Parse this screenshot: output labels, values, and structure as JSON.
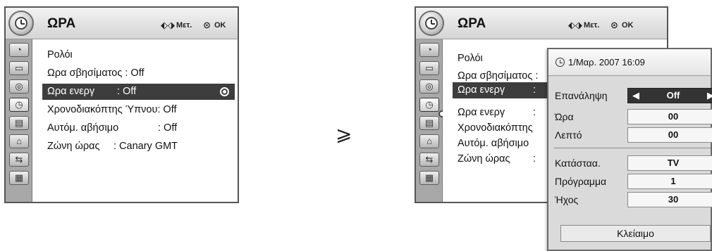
{
  "left_panel": {
    "title": "ΩΡΑ",
    "hint_move": "Μετ.",
    "hint_ok": "OK",
    "items": [
      {
        "label": "Ρολόι",
        "value": ""
      },
      {
        "label": "Ωρα σβησίματος : Off",
        "value": ""
      },
      {
        "label": "Ωρα ενεργ",
        "value": ": Off"
      },
      {
        "label": "Χρονοδιακόπτης Ύπνου: Off",
        "value": ""
      },
      {
        "label": "Αυτόμ. αβήσιμο",
        "value": ": Off"
      },
      {
        "label": "Ζώνη ώρας",
        "value": ": Canary GMT"
      }
    ]
  },
  "right_panel": {
    "title": "ΩΡΑ",
    "hint_move": "Μετ.",
    "hint_ok": "OK",
    "items": [
      {
        "label": "Ρολόι"
      },
      {
        "label": "Ωρα σβησίματος :"
      },
      {
        "label": "Ωρα ενεργ"
      },
      {
        "label": "Ωρα ενεργ"
      },
      {
        "label": "Χρονοδιακόπτης"
      },
      {
        "label": "Αυτόμ. αβήσιμο"
      },
      {
        "label": "Ζώνη ώρας"
      }
    ],
    "colons": [
      ":",
      ":",
      ":"
    ]
  },
  "popup": {
    "datetime": "1/Μαρ. 2007 16:09",
    "rows": [
      {
        "label": "Επανάληψη",
        "value": "Off"
      },
      {
        "label": "Ώρα",
        "value": "00"
      },
      {
        "label": "Λεπτό",
        "value": "00"
      },
      {
        "label": "Κατάσταα.",
        "value": "TV"
      },
      {
        "label": "Πρόγραμμα",
        "value": "1"
      },
      {
        "label": "Ήχος",
        "value": "30"
      }
    ],
    "lock_button": "Κλείαιμο"
  },
  "arrow": "⩾",
  "icons": [
    "clock-icon",
    "picture-icon",
    "screen-icon",
    "audio-icon",
    "time-icon",
    "option-icon",
    "lock-icon",
    "input-icon",
    "usb-icon"
  ],
  "colors": {
    "highlight": "#3d3d3d",
    "sidebar": "#a8a8a8",
    "titlebar": "#dcdcdc"
  }
}
